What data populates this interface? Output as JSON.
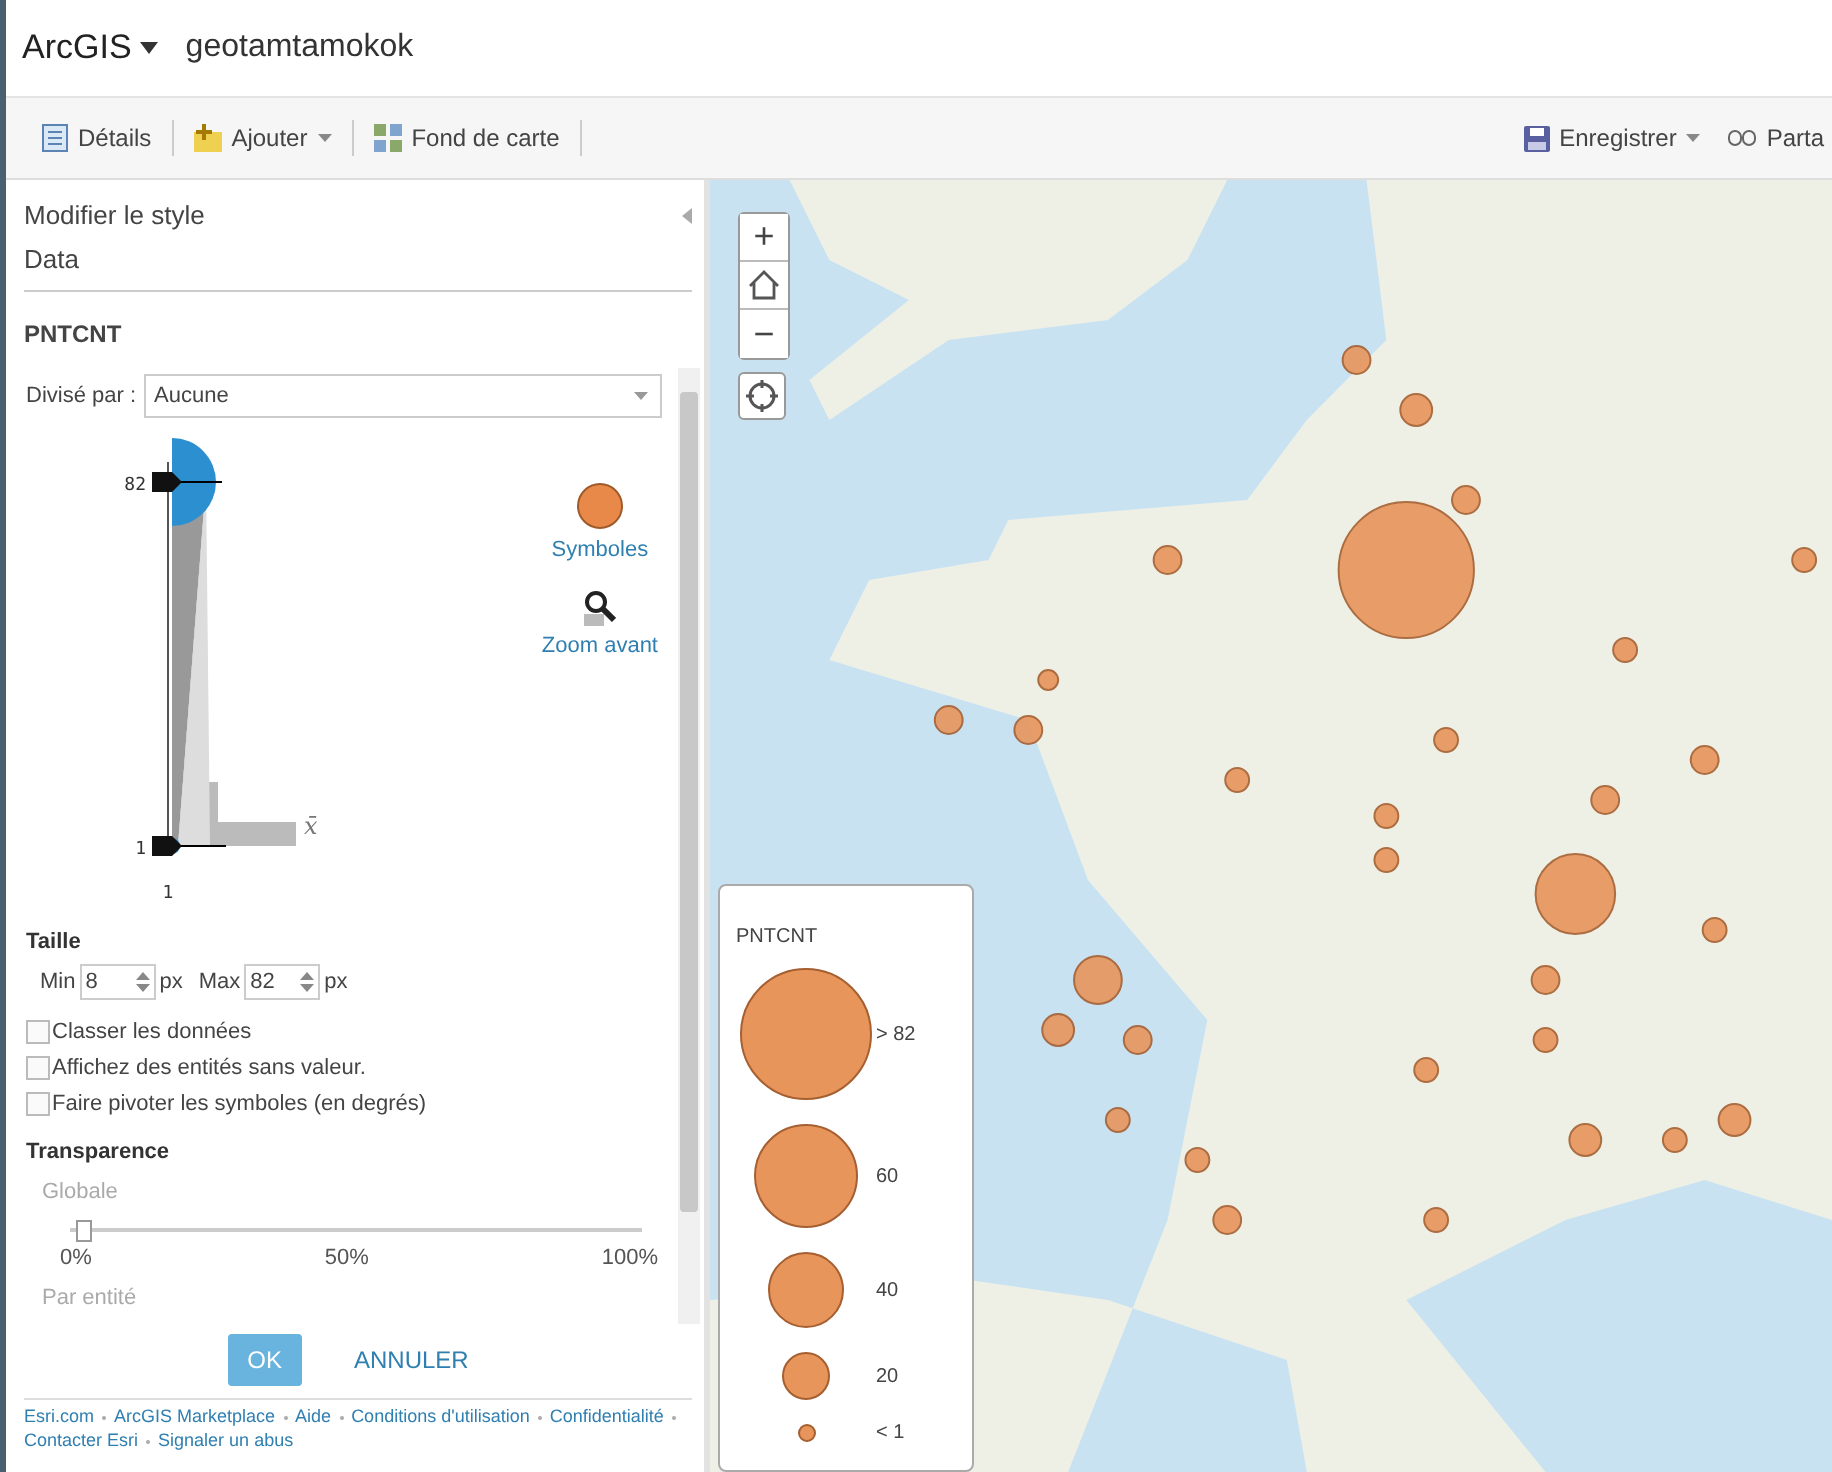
{
  "header": {
    "app_name": "ArcGIS",
    "map_title": "geotamtamokok"
  },
  "toolbar": {
    "left": [
      {
        "label": "Détails",
        "dropdown": false
      },
      {
        "label": "Ajouter",
        "dropdown": true
      },
      {
        "label": "Fond de carte",
        "dropdown": false
      }
    ],
    "right": [
      {
        "label": "Enregistrer",
        "dropdown": true
      },
      {
        "label": "Parta",
        "dropdown": false
      }
    ]
  },
  "panel": {
    "title": "Modifier le style",
    "subtitle": "Data",
    "field": "PNTCNT",
    "divide_label": "Divisé par :",
    "divide_value": "Aucune",
    "chart": {
      "max_label": "82",
      "min_label": "1",
      "x_label": "1",
      "mean_label": "x̄"
    },
    "options": [
      {
        "label": "Symboles",
        "kind": "symbol"
      },
      {
        "label": "Zoom avant",
        "kind": "zoom"
      }
    ],
    "size": {
      "title": "Taille",
      "fields": [
        {
          "label": "Min",
          "value": "8",
          "unit": "px"
        },
        {
          "label": "Max",
          "value": "82",
          "unit": "px"
        }
      ]
    },
    "checkboxes": [
      {
        "label": "Classer les données",
        "checked": false
      },
      {
        "label": "Affichez des entités sans valeur.",
        "checked": false
      },
      {
        "label": "Faire pivoter les symboles (en degrés)",
        "checked": false
      }
    ],
    "transparency": {
      "title": "Transparence",
      "global_label": "Globale",
      "level": 0.02,
      "ticks": [
        "0%",
        "50%",
        "100%"
      ],
      "per_feature_label": "Par entité"
    },
    "buttons": [
      {
        "label": "OK",
        "kind": "primary"
      },
      {
        "label": "ANNULER",
        "kind": "link"
      }
    ]
  },
  "footer_links": [
    "Esri.com",
    "ArcGIS Marketplace",
    "Aide",
    "Conditions d'utilisation",
    "Confidentialité",
    "Contacter Esri",
    "Signaler un abus"
  ],
  "map": {
    "controls": [
      {
        "kind": "zoom_in",
        "symbol": "+"
      },
      {
        "kind": "home"
      },
      {
        "kind": "zoom_out",
        "symbol": "−"
      },
      {
        "kind": "locate"
      }
    ],
    "legend": {
      "title": "PNTCNT",
      "items": [
        {
          "label": "> 82"
        },
        {
          "label": "60"
        },
        {
          "label": "40"
        },
        {
          "label": "20"
        },
        {
          "label": "< 1"
        }
      ]
    }
  }
}
